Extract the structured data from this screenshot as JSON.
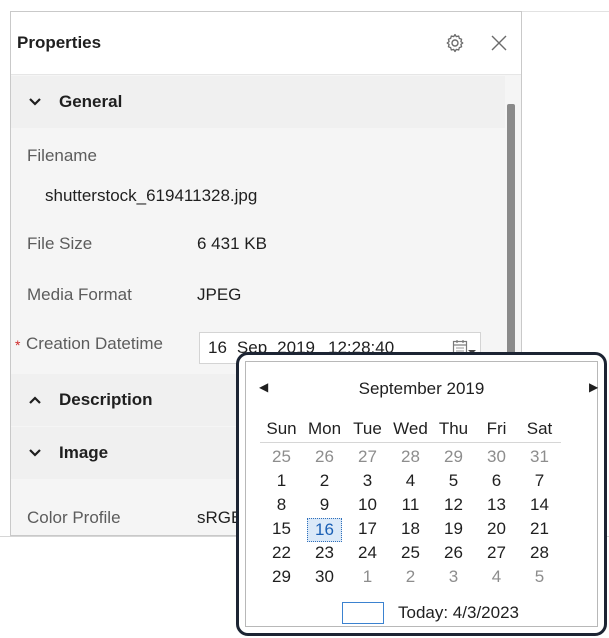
{
  "panel": {
    "title": "Properties",
    "icons": {
      "settings": "gear-icon",
      "close": "close-icon"
    }
  },
  "sections": {
    "general": {
      "label": "General",
      "state": "expanded"
    },
    "description": {
      "label": "Description",
      "state": "collapsed"
    },
    "image": {
      "label": "Image",
      "state": "expanded"
    }
  },
  "fields": {
    "filename": {
      "label": "Filename",
      "value": "shutterstock_619411328.jpg"
    },
    "file_size": {
      "label": "File Size",
      "value": "6 431 KB"
    },
    "media_format": {
      "label": "Media Format",
      "value": "JPEG"
    },
    "creation_datetime": {
      "label": "Creation Datetime",
      "required_mark": "*",
      "day": "16",
      "month": "Sep",
      "year": "2019",
      "time": "12:28:40"
    },
    "color_profile": {
      "label": "Color Profile",
      "value": "sRGB"
    }
  },
  "calendar": {
    "month_title": "September 2019",
    "prev": "◀",
    "next": "▶",
    "weekdays": [
      "Sun",
      "Mon",
      "Tue",
      "Wed",
      "Thu",
      "Fri",
      "Sat"
    ],
    "weeks": [
      [
        "25",
        "26",
        "27",
        "28",
        "29",
        "30",
        "31"
      ],
      [
        "1",
        "2",
        "3",
        "4",
        "5",
        "6",
        "7"
      ],
      [
        "8",
        "9",
        "10",
        "11",
        "12",
        "13",
        "14"
      ],
      [
        "15",
        "16",
        "17",
        "18",
        "19",
        "20",
        "21"
      ],
      [
        "22",
        "23",
        "24",
        "25",
        "26",
        "27",
        "28"
      ],
      [
        "29",
        "30",
        "1",
        "2",
        "3",
        "4",
        "5"
      ]
    ],
    "selected": "16",
    "today_label": "Today: 4/3/2023",
    "accent": "#2f6fba"
  }
}
